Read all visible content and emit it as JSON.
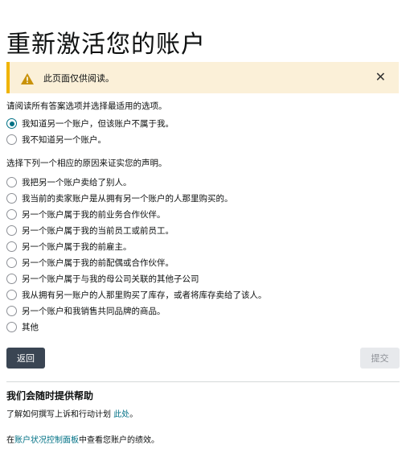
{
  "page": {
    "title": "重新激活您的账户"
  },
  "alert": {
    "icon": "warning-icon",
    "text": "此页面仅供阅读。",
    "close_glyph": "✕"
  },
  "question1": {
    "label": "请阅读所有答案选项并选择最适用的选项。",
    "options": [
      {
        "label": "我知道另一个账户，但该账户不属于我。",
        "checked": true
      },
      {
        "label": "我不知道另一个账户。",
        "checked": false
      }
    ]
  },
  "question2": {
    "label": "选择下列一个相应的原因来证实您的声明。",
    "options": [
      {
        "label": "我把另一个账户卖给了别人。"
      },
      {
        "label": "我当前的卖家账户是从拥有另一个账户的人那里购买的。"
      },
      {
        "label": "另一个账户属于我的前业务合作伙伴。"
      },
      {
        "label": "另一个账户属于我的当前员工或前员工。"
      },
      {
        "label": "另一个账户属于我的前雇主。"
      },
      {
        "label": "另一个账户属于我的前配偶或合作伙伴。"
      },
      {
        "label": "另一个账户属于与我的母公司关联的其他子公司"
      },
      {
        "label": "我从拥有另一账户的人那里购买了库存，或者将库存卖给了该人。"
      },
      {
        "label": "另一个账户和我销售共同品牌的商品。"
      },
      {
        "label": "其他"
      }
    ]
  },
  "buttons": {
    "back": "返回",
    "submit": "提交"
  },
  "help": {
    "title": "我们会随时提供帮助",
    "line1_prefix": "了解如何撰写上诉和行动计划 ",
    "line1_link": "此处",
    "line1_suffix": "。",
    "line2_prefix": "在",
    "line2_link": "账户状况控制面板",
    "line2_suffix": "中查看您账户的绩效。"
  },
  "colors": {
    "accent": "#007185",
    "alert_bg": "#fbf0d8",
    "alert_border": "#f0b400",
    "back_button": "#3a4553",
    "submit_disabled": "#e7e9ec"
  }
}
